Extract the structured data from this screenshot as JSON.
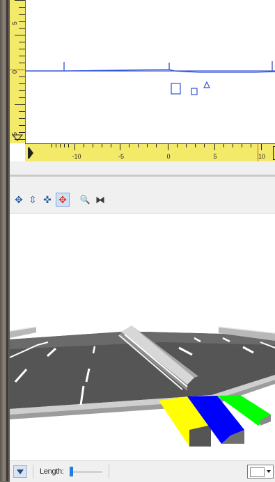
{
  "profile": {
    "v_ruler_labels": [
      "5",
      "0",
      "-5"
    ],
    "h_ruler_labels": [
      "-10",
      "-5",
      "0",
      "5",
      "10"
    ],
    "line_color": "#2f4fd8",
    "ruler_color": "#f3ea6a"
  },
  "viewer": {
    "tools": [
      {
        "name": "rotate-tool",
        "glyph": "✥"
      },
      {
        "name": "move-vertical-tool",
        "glyph": "⇳"
      },
      {
        "name": "pan-tool",
        "glyph": "✜"
      },
      {
        "name": "orbit-tool",
        "glyph": "✥"
      },
      {
        "name": "zoom-tool",
        "glyph": "🔍"
      },
      {
        "name": "fit-view-tool",
        "glyph": "⧓"
      }
    ],
    "active_tool": "orbit-tool",
    "lane_colors": [
      "#ffff00",
      "#0000ff",
      "#00ff00"
    ]
  },
  "statusbar": {
    "length_label": "Length:",
    "length_value": 0.05,
    "color_value": "#ffffff"
  }
}
